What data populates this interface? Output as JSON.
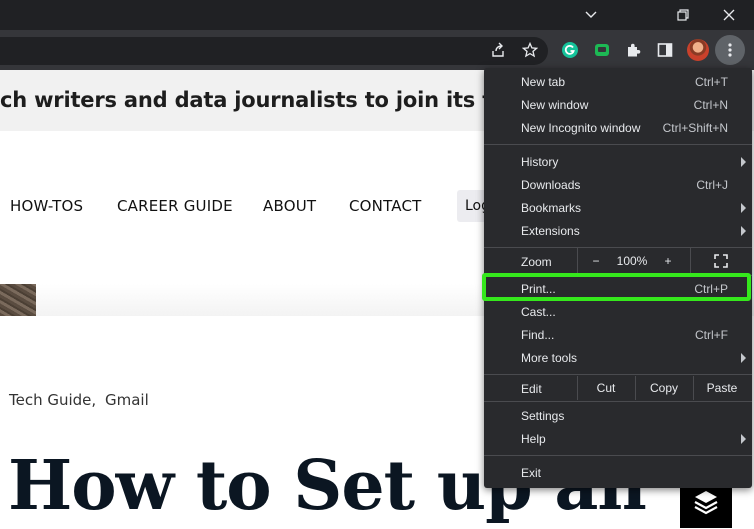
{
  "page": {
    "banner_text": "ch writers and data journalists to join its tea",
    "nav": [
      "HOW-TOS",
      "CAREER GUIDE",
      "ABOUT",
      "CONTACT"
    ],
    "login_label": "Log",
    "categories": [
      "Tech Guide,",
      "Gmail"
    ],
    "headline": "How to Set up an"
  },
  "icons": {
    "tab_search": "chevron-down-icon",
    "restore": "restore-window-icon",
    "close": "close-icon",
    "share": "share-icon",
    "star": "star-icon",
    "grammarly": "grammarly-icon",
    "extension_green": "extension-icon",
    "puzzle": "puzzle-icon",
    "side_panel": "side-panel-icon",
    "kebab": "kebab-menu-icon",
    "layers": "layers-icon"
  },
  "colors": {
    "highlight": "#35e81c",
    "menu_bg": "#292a2d"
  },
  "menu": {
    "new_tab": {
      "label": "New tab",
      "shortcut": "Ctrl+T"
    },
    "new_window": {
      "label": "New window",
      "shortcut": "Ctrl+N"
    },
    "new_incognito": {
      "label": "New Incognito window",
      "shortcut": "Ctrl+Shift+N"
    },
    "history": {
      "label": "History"
    },
    "downloads": {
      "label": "Downloads",
      "shortcut": "Ctrl+J"
    },
    "bookmarks": {
      "label": "Bookmarks"
    },
    "extensions": {
      "label": "Extensions"
    },
    "zoom": {
      "label": "Zoom",
      "minus": "−",
      "value": "100%",
      "plus": "+"
    },
    "print": {
      "label": "Print...",
      "shortcut": "Ctrl+P"
    },
    "cast": {
      "label": "Cast..."
    },
    "find": {
      "label": "Find...",
      "shortcut": "Ctrl+F"
    },
    "more_tools": {
      "label": "More tools"
    },
    "edit": {
      "label": "Edit",
      "cut": "Cut",
      "copy": "Copy",
      "paste": "Paste"
    },
    "settings": {
      "label": "Settings"
    },
    "help": {
      "label": "Help"
    },
    "exit": {
      "label": "Exit"
    }
  }
}
